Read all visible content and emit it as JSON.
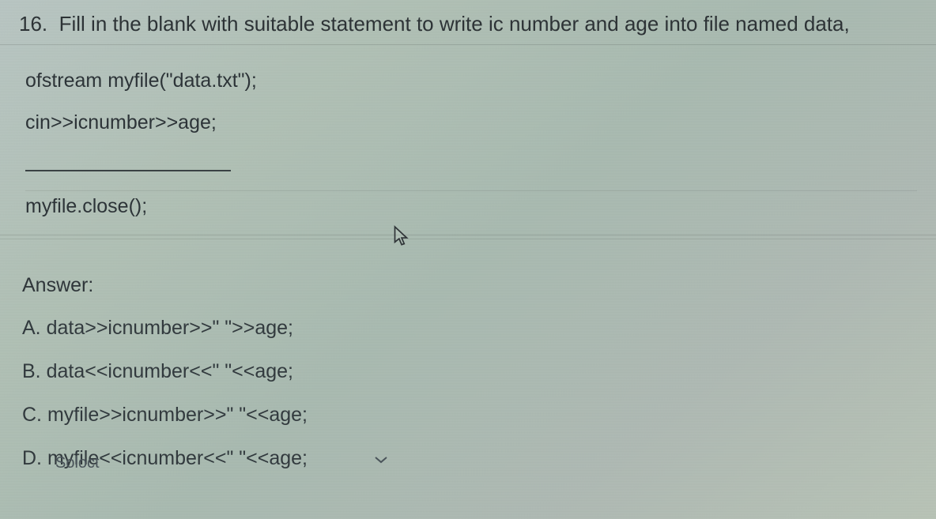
{
  "question": {
    "number": "16.",
    "text": "Fill in the blank with suitable statement to write ic number and age into file named data,"
  },
  "code": {
    "line1": "ofstream myfile(\"data.txt\");",
    "line2": "cin>>icnumber>>age;",
    "line3_blank": "",
    "line4": "myfile.close();"
  },
  "answer_label": "Answer:",
  "options": {
    "A": "A. data>>icnumber>>\" \">>age;",
    "B": "B. data<<icnumber<<\" \"<<age;",
    "C": "C. myfile>>icnumber>>\" \"<<age;",
    "D": "D. myfile<<icnumber<<\" \"<<age;"
  },
  "partial_footer": "Soloct",
  "icons": {
    "cursor": "cursor-icon",
    "chevron": "chevron-down-icon"
  }
}
